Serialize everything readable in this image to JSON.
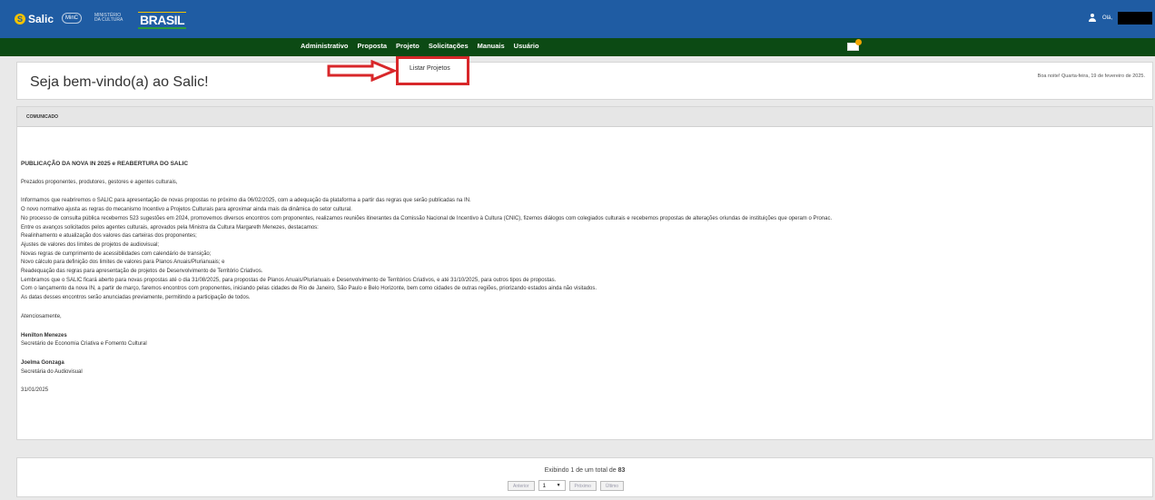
{
  "header": {
    "logo_text": "Salic",
    "gov_text": "MinC",
    "minc_text": "MINISTÉRIO DA CULTURA",
    "brasil_text": "BRASIL",
    "user_greeting": "Olá,"
  },
  "nav": {
    "items": [
      "Administrativo",
      "Proposta",
      "Projeto",
      "Solicitações",
      "Manuais",
      "Usuário"
    ],
    "dropdown_item": "Listar Projetos"
  },
  "welcome": {
    "title": "Seja bem-vindo(a) ao Salic!",
    "greeting": "Boa noite! Quarta-feira, 19 de fevereiro de 2025."
  },
  "notice": {
    "header": "COMUNICADO",
    "headline": "PUBLICAÇÃO DA NOVA IN 2025 e REABERTURA DO SALIC",
    "salutation": "Prezados proponentes, produtores, gestores e agentes culturais,",
    "lines": [
      "Informamos que reabriremos o SALIC para apresentação de novas propostas no próximo dia 06/02/2025, com a adequação da plataforma a partir das regras que serão publicadas na IN.",
      "O novo normativo ajusta as regras do mecanismo Incentivo a Projetos Culturais para aproximar ainda mais da dinâmica do setor cultural.",
      "No processo de consulta pública recebemos 523 sugestões em 2024, promovemos diversos encontros com proponentes, realizamos reuniões itinerantes da Comissão Nacional de Incentivo à Cultura (CNIC), fizemos diálogos com colegiados culturais e recebemos propostas de alterações oriundas de instituições que operam o Pronac.",
      "Entre os avanços solicitados pelos agentes culturais, aprovados pela Ministra da Cultura Margareth Menezes, destacamos:",
      "Realinhamento e atualização dos valores das carteiras dos proponentes;",
      "Ajustes de valores dos limites de projetos de audiovisual;",
      "Novas regras de cumprimento de acessibilidades com calendário de transição;",
      "Novo cálculo para definição dos limites de valores para Planos Anuais/Plurianuais; e",
      "Readequação das regras para apresentação de projetos de Desenvolvimento de Território Criativos.",
      "Lembramos que o SALIC ficará aberto para novas propostas até o dia 31/08/2025, para propostas de Planos Anuais/Plurianuais e Desenvolvimento de Territórios Criativos, e até 31/10/2025, para outros tipos de propostas.",
      "Com o lançamento da nova IN, a partir de março, faremos encontros com proponentes, iniciando pelas cidades de Rio de Janeiro, São Paulo e Belo Horizonte, bem como cidades de outras regiões, priorizando estados ainda não visitados.",
      "As datas desses encontros serão anunciadas previamente, permitindo a participação de todos."
    ],
    "closing": "Atenciosamente,",
    "signer1_name": "Henilton Menezes",
    "signer1_role": "Secretário de Economia Criativa e Fomento Cultural",
    "signer2_name": "Joelma Gonzaga",
    "signer2_role": "Secretária do Audiovisual",
    "date": "31/01/2025"
  },
  "pager": {
    "info_prefix": "Exibindo 1 de um total de",
    "total": "83",
    "prev_label": "Anterior",
    "page_value": "1",
    "next_label": "Próximo",
    "last_label": "Último"
  },
  "colors": {
    "topbar": "#1f5ca3",
    "navbar": "#0c4a14",
    "highlight": "#d8272a"
  }
}
